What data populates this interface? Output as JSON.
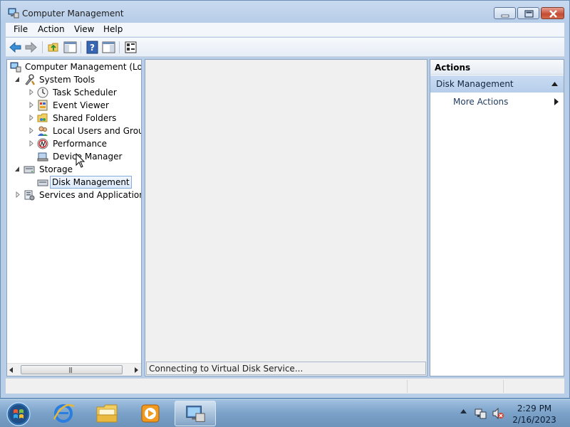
{
  "window": {
    "title": "Computer Management"
  },
  "menu": [
    "File",
    "Action",
    "View",
    "Help"
  ],
  "tree": {
    "root": "Computer Management (Local",
    "items": [
      {
        "label": "System Tools",
        "icon": "tools-icon",
        "expanded": true
      },
      {
        "label": "Task Scheduler",
        "icon": "clock-icon"
      },
      {
        "label": "Event Viewer",
        "icon": "event-viewer-icon"
      },
      {
        "label": "Shared Folders",
        "icon": "shared-folder-icon"
      },
      {
        "label": "Local Users and Groups",
        "icon": "users-icon"
      },
      {
        "label": "Performance",
        "icon": "performance-icon"
      },
      {
        "label": "Device Manager",
        "icon": "device-manager-icon"
      },
      {
        "label": "Storage",
        "icon": "storage-icon",
        "expanded": true
      },
      {
        "label": "Disk Management",
        "icon": "disk-icon",
        "selected": true
      },
      {
        "label": "Services and Applications",
        "icon": "services-icon"
      }
    ]
  },
  "center": {
    "status": "Connecting to Virtual Disk Service..."
  },
  "actions": {
    "header": "Actions",
    "section": "Disk Management",
    "more": "More Actions"
  },
  "taskbar": {
    "time": "2:29 PM",
    "date": "2/16/2023"
  },
  "colors": {
    "title_bar": "#c8daf0",
    "selection": "#dbe9fb",
    "actions_section": "#b6cdea",
    "taskbar": "#7aa1c8",
    "close_button": "#c44a31"
  }
}
